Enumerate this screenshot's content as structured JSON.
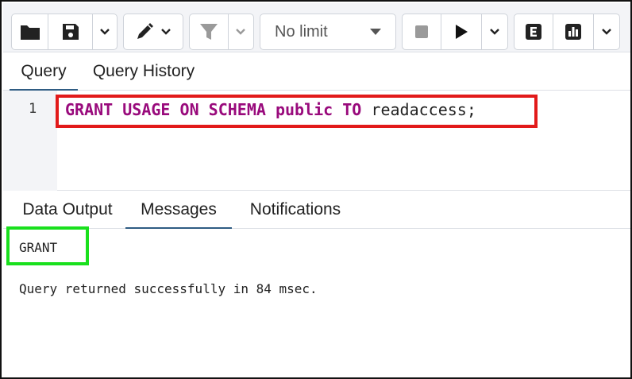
{
  "toolbar": {
    "limit_label": "No limit",
    "icons": [
      "folder-icon",
      "save-icon",
      "chevron-down-icon",
      "pencil-icon",
      "filter-icon",
      "stop-icon",
      "play-icon",
      "explain-icon",
      "analyze-icon"
    ]
  },
  "query_tabs": [
    {
      "label": "Query",
      "active": true
    },
    {
      "label": "Query History",
      "active": false
    }
  ],
  "editor": {
    "line_number": "1",
    "tokens": [
      {
        "text": "GRANT",
        "kind": "keyword"
      },
      {
        "text": " "
      },
      {
        "text": "USAGE",
        "kind": "keyword"
      },
      {
        "text": " "
      },
      {
        "text": "ON",
        "kind": "keyword"
      },
      {
        "text": " "
      },
      {
        "text": "SCHEMA",
        "kind": "keyword"
      },
      {
        "text": " "
      },
      {
        "text": "public",
        "kind": "keyword"
      },
      {
        "text": " "
      },
      {
        "text": "TO",
        "kind": "keyword"
      },
      {
        "text": " "
      },
      {
        "text": "readaccess;",
        "kind": "identifier"
      }
    ]
  },
  "output_tabs": [
    {
      "label": "Data Output",
      "active": false
    },
    {
      "label": "Messages",
      "active": true
    },
    {
      "label": "Notifications",
      "active": false
    }
  ],
  "messages": {
    "result": "GRANT",
    "status": "Query returned successfully in 84 msec."
  },
  "colors": {
    "keyword": "#990a7c",
    "tab_underline": "#2f5c83",
    "highlight_red": "#e21a1a",
    "highlight_green": "#19e01d"
  }
}
